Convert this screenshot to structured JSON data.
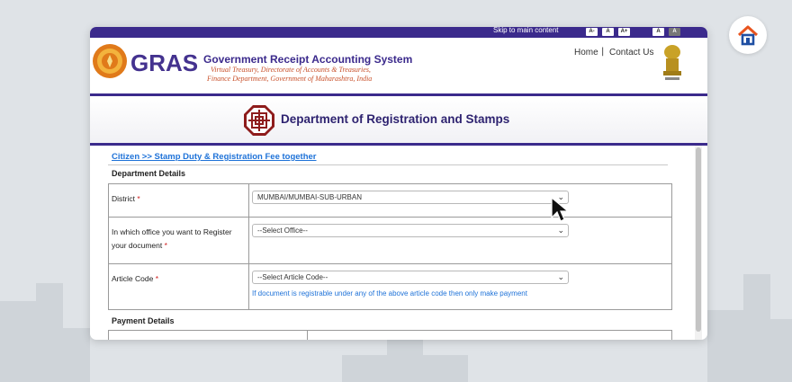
{
  "topbar": {
    "skip_link": "Skip to main content",
    "font_buttons": [
      "A-",
      "A",
      "A+"
    ],
    "contrast_buttons": [
      "A",
      "A"
    ]
  },
  "header": {
    "brand_word": "GRAS",
    "title": "Government Receipt Accounting System",
    "subtitle_1": "Virtual Treasury, Directorate of Accounts & Treasuries,",
    "subtitle_2": "Finance Department, Government of Maharashtra, India",
    "nav": {
      "home": "Home",
      "separator": "|",
      "contact": "Contact Us"
    }
  },
  "department": {
    "title": "Department of Registration and Stamps"
  },
  "breadcrumb": "Citizen >> Stamp Duty & Registration Fee together",
  "department_details": {
    "heading": "Department Details",
    "rows": [
      {
        "label": "District",
        "required": "*",
        "value": "MUMBAI/MUMBAI-SUB-URBAN"
      },
      {
        "label_1": "In which office you want to Register",
        "label_2": "your document",
        "required": "*",
        "value": "--Select Office--"
      },
      {
        "label": "Article Code",
        "required": "*",
        "value": "--Select Article Code--",
        "hint": "If document is registrable under any of the above article code then only make payment"
      }
    ]
  },
  "payment_details": {
    "heading": "Payment Details"
  },
  "colors": {
    "brand_purple": "#3b2a8c",
    "link_blue": "#1e72d8",
    "required_red": "#d02020"
  },
  "icons": {
    "corner_logo": "home-icon",
    "dropdown": "chevron-down-icon",
    "pointer": "mouse-cursor-icon"
  }
}
